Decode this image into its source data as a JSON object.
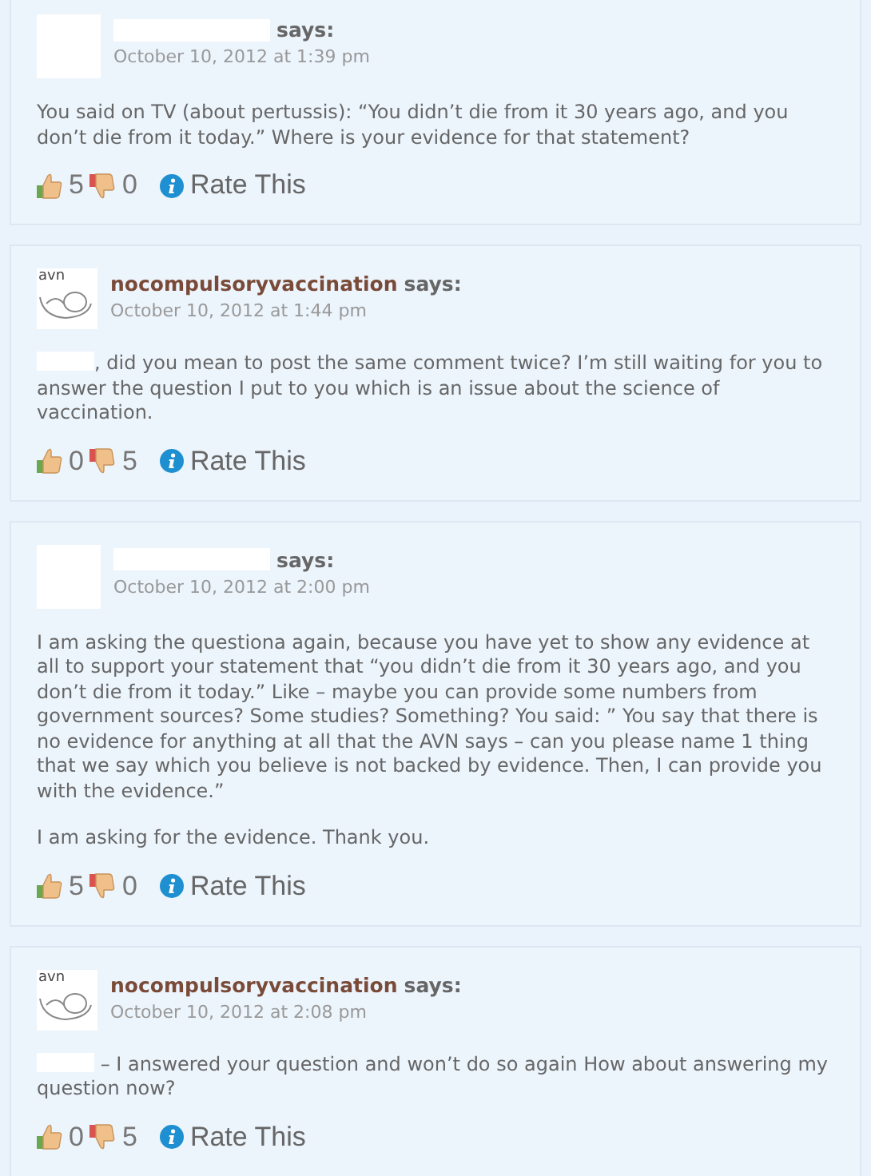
{
  "comments": [
    {
      "author": {
        "redacted": true
      },
      "avatar": {
        "kind": "blank"
      },
      "says": "says:",
      "date": "October 10, 2012 at 1:39 pm",
      "paragraphs": [
        {
          "redacted_prefix": false,
          "text": "You said on TV (about pertussis): “You didn’t die from it 30 years ago, and you don’t die from it today.” Where is your evidence for that statement?"
        }
      ],
      "likes": "5",
      "dislikes": "0",
      "rate": "Rate This"
    },
    {
      "author": {
        "redacted": false,
        "name": "nocompulsoryvaccination"
      },
      "avatar": {
        "kind": "logo",
        "text": "avn"
      },
      "says": "says:",
      "date": "October 10, 2012 at 1:44 pm",
      "paragraphs": [
        {
          "redacted_prefix": true,
          "text": ", did you mean to post the same comment twice? I’m still waiting for you to answer the question I put to you which is an issue about the science of vaccination."
        }
      ],
      "likes": "0",
      "dislikes": "5",
      "rate": "Rate This"
    },
    {
      "author": {
        "redacted": true
      },
      "avatar": {
        "kind": "blank"
      },
      "says": "says:",
      "date": "October 10, 2012 at 2:00 pm",
      "paragraphs": [
        {
          "redacted_prefix": false,
          "text": "I am asking the questiona again, because you have yet to show any evidence at all to support your statement that “you didn’t die from it 30 years ago, and you don’t die from it today.” Like – maybe you can provide some numbers from government sources? Some studies? Something? You said: ” You say that there is no evidence for anything at all that the AVN says – can you please name 1 thing that we say which you believe is not backed by evidence. Then, I can provide you with the evidence.”"
        },
        {
          "redacted_prefix": false,
          "text": "I am asking for the evidence. Thank you."
        }
      ],
      "likes": "5",
      "dislikes": "0",
      "rate": "Rate This"
    },
    {
      "author": {
        "redacted": false,
        "name": "nocompulsoryvaccination"
      },
      "avatar": {
        "kind": "logo",
        "text": "avn"
      },
      "says": "says:",
      "date": "October 10, 2012 at 2:08 pm",
      "paragraphs": [
        {
          "redacted_prefix": true,
          "text": " – I answered your question and won’t do so again How about answering my question now?"
        }
      ],
      "likes": "0",
      "dislikes": "5",
      "rate": "Rate This"
    }
  ]
}
